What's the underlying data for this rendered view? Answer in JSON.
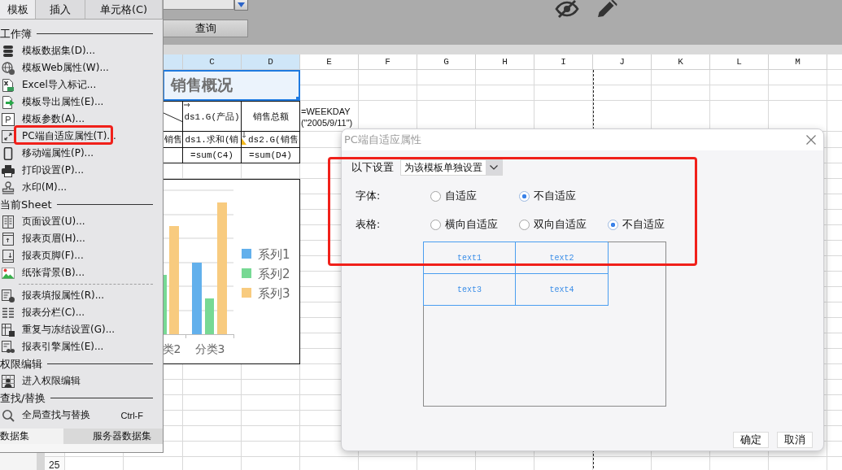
{
  "toolbar": {
    "query_button": "查询"
  },
  "menu": {
    "tabs": [
      {
        "label": "模板",
        "selected": true
      },
      {
        "label": "插入",
        "selected": false
      },
      {
        "label": "单元格(C)",
        "selected": false
      }
    ],
    "sections": [
      {
        "title": "工作簿",
        "groups": [
          {
            "items": [
              {
                "label": "模板数据集(D)...",
                "highlighted": false
              },
              {
                "label": "模板Web属性(W)...",
                "highlighted": false
              },
              {
                "label": "Excel导入标记...",
                "highlighted": false
              },
              {
                "label": "模板导出属性(E)...",
                "highlighted": false
              },
              {
                "label": "模板参数(A)...",
                "icon_char": "P",
                "highlighted": false
              },
              {
                "label": "PC端自适应属性(T)...",
                "highlighted": true
              },
              {
                "label": "移动端属性(P)...",
                "highlighted": false
              },
              {
                "label": "打印设置(P)...",
                "highlighted": false
              },
              {
                "label": "水印(M)...",
                "highlighted": false
              }
            ]
          }
        ]
      },
      {
        "title": "当前Sheet",
        "groups": [
          {
            "items": [
              {
                "label": "页面设置(U)...",
                "highlighted": false
              },
              {
                "label": "报表页眉(H)...",
                "highlighted": false
              },
              {
                "label": "报表页脚(F)...",
                "highlighted": false
              },
              {
                "label": "纸张背景(B)...",
                "highlighted": false
              }
            ]
          },
          {
            "items": [
              {
                "label": "报表填报属性(R)...",
                "highlighted": false
              },
              {
                "label": "报表分栏(C)...",
                "highlighted": false
              },
              {
                "label": "重复与冻结设置(G)...",
                "highlighted": false
              },
              {
                "label": "报表引擎属性(E)...",
                "highlighted": false
              }
            ]
          }
        ]
      },
      {
        "title": "权限编辑",
        "groups": [
          {
            "items": [
              {
                "label": "进入权限编辑",
                "highlighted": false
              }
            ]
          }
        ]
      },
      {
        "title": "查找/替换",
        "groups": [
          {
            "items": [
              {
                "label": "全局查找与替换",
                "shortcut": "Ctrl-F",
                "highlighted": false
              }
            ]
          }
        ]
      }
    ],
    "bottom_tabs": [
      {
        "label": "数据集",
        "selected": true
      },
      {
        "label": "服务器数据集",
        "selected": false
      }
    ]
  },
  "sheet": {
    "columns": [
      {
        "selected": true,
        "page_break": false
      },
      {
        "label": "C",
        "selected": true,
        "page_break": false
      },
      {
        "label": "D",
        "selected": true,
        "page_break": false
      },
      {
        "label": "E",
        "selected": false,
        "page_break": false
      },
      {
        "label": "F",
        "selected": false,
        "page_break": false
      },
      {
        "label": "G",
        "selected": false,
        "page_break": false
      },
      {
        "label": "H",
        "selected": false,
        "page_break": false
      },
      {
        "label": "I",
        "selected": false,
        "page_break": false
      },
      {
        "label": "J",
        "selected": false,
        "page_break": true
      },
      {
        "label": "K",
        "selected": false,
        "page_break": false
      },
      {
        "label": "L",
        "selected": false,
        "page_break": false
      },
      {
        "label": "M",
        "selected": false,
        "page_break": false
      }
    ],
    "title_cell": {
      "text": "销售概况",
      "selected": true
    },
    "report_rows": [
      {
        "cells": [
          {
            "kind": "diagonal"
          },
          {
            "kind": "text",
            "text": "ds1.G(产品)",
            "expand_across": true,
            "expand_down": false,
            "flag": false
          },
          {
            "kind": "text",
            "text": "销售总额",
            "expand_across": false,
            "expand_down": false,
            "flag": false
          }
        ]
      },
      {
        "cells": [
          {
            "kind": "text",
            "text": "销售",
            "expand_across": false,
            "expand_down": false,
            "flag": false
          },
          {
            "kind": "text",
            "text": "ds1.求和(销",
            "expand_across": false,
            "expand_down": false,
            "flag": false
          },
          {
            "kind": "text",
            "text": "ds2.G(销售",
            "expand_across": false,
            "expand_down": true,
            "flag": true
          }
        ]
      },
      {
        "cells": [
          {
            "kind": "blank"
          },
          {
            "kind": "text",
            "text": "=sum(C4)",
            "expand_across": false,
            "expand_down": false,
            "flag": false
          },
          {
            "kind": "text",
            "text": "=sum(D4)",
            "expand_across": false,
            "expand_down": false,
            "flag": false
          }
        ]
      }
    ],
    "formula_cell": "=WEEKDAY(\"2005/9/11\")",
    "chart": {
      "legend": [
        {
          "label": "系列1",
          "color": "#62b0ec"
        },
        {
          "label": "系列2",
          "color": "#77d994"
        },
        {
          "label": "系列3",
          "color": "#f8cb7f"
        }
      ],
      "categories": [
        "类2",
        "分类3"
      ]
    },
    "row_number": "25"
  },
  "dialog": {
    "title": "PC端自适应属性",
    "highlighted": true,
    "scope": {
      "label": "以下设置",
      "value": "为该模板单独设置"
    },
    "settings": [
      {
        "label": "字体:",
        "options": [
          {
            "label": "自适应",
            "selected": false
          },
          {
            "label": "不自适应",
            "selected": true
          }
        ]
      },
      {
        "label": "表格:",
        "options": [
          {
            "label": "横向自适应",
            "selected": false
          },
          {
            "label": "双向自适应",
            "selected": false
          },
          {
            "label": "不自适应",
            "selected": true
          }
        ]
      }
    ],
    "preview_cells": [
      "text1",
      "text2",
      "text3",
      "text4"
    ],
    "buttons": [
      "确定",
      "取消"
    ]
  }
}
